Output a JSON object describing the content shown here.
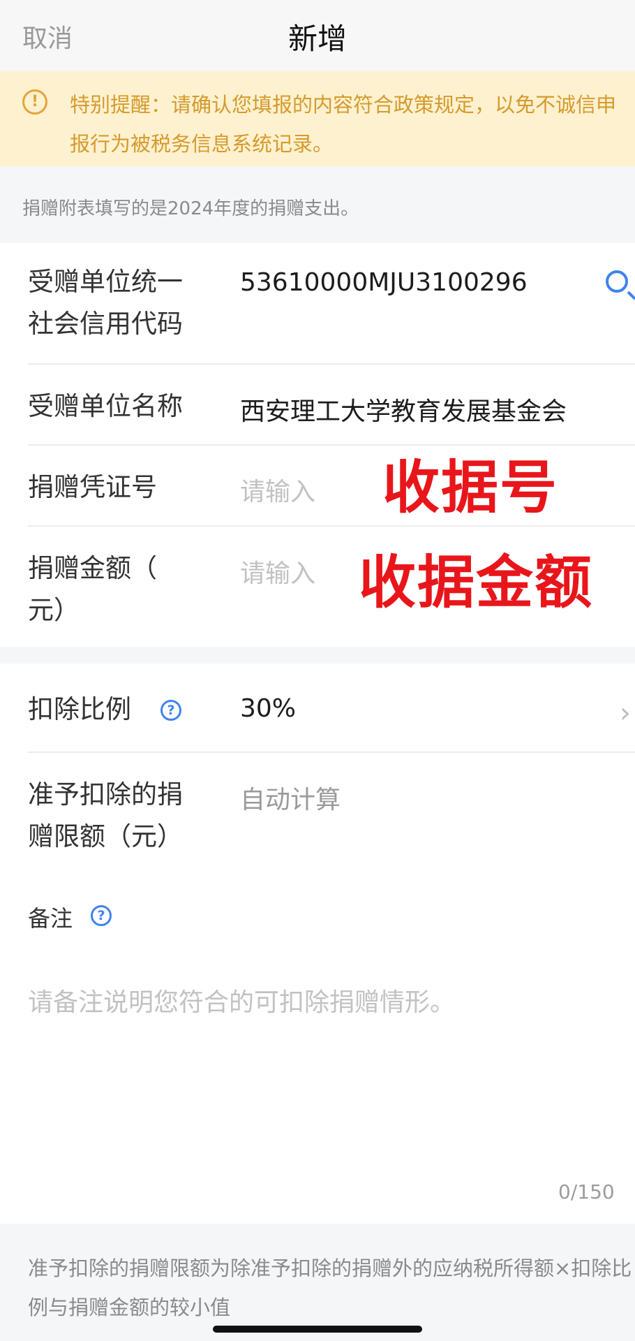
{
  "header": {
    "cancel": "取消",
    "title": "新增"
  },
  "notice": {
    "icon": "exclamation-circle-icon",
    "text": "特别提醒：请确认您填报的内容符合政策规定，以免不诚信申报行为被税务信息系统记录。"
  },
  "info": "捐赠附表填写的是2024年度的捐赠支出。",
  "form": {
    "recipient_code": {
      "label_line1": "受赠单位统一",
      "label_line2": "社会信用代码",
      "value": "53610000MJU3100296"
    },
    "recipient_name": {
      "label": "受赠单位名称",
      "value": "西安理工大学教育发展基金会"
    },
    "voucher_no": {
      "label": "捐赠凭证号",
      "placeholder": "请输入",
      "annotation": "收据号"
    },
    "amount": {
      "label_line1": "捐赠金额（",
      "label_line2": "元）",
      "placeholder": "请输入",
      "annotation": "收据金额"
    }
  },
  "deduction": {
    "ratio": {
      "label": "扣除比例",
      "value": "30%"
    },
    "limit": {
      "label_line1": "准予扣除的捐",
      "label_line2": "赠限额（元）",
      "value": "自动计算"
    }
  },
  "remark": {
    "label": "备注",
    "placeholder": "请备注说明您符合的可扣除捐赠情形。",
    "counter": "0/150"
  },
  "footnote": "准予扣除的捐赠限额为除准予扣除的捐赠外的应纳税所得额×扣除比例与捐赠金额的较小值",
  "colors": {
    "accent": "#3f82f0",
    "warning": "#d69a2d",
    "annotation": "#e8161b"
  }
}
